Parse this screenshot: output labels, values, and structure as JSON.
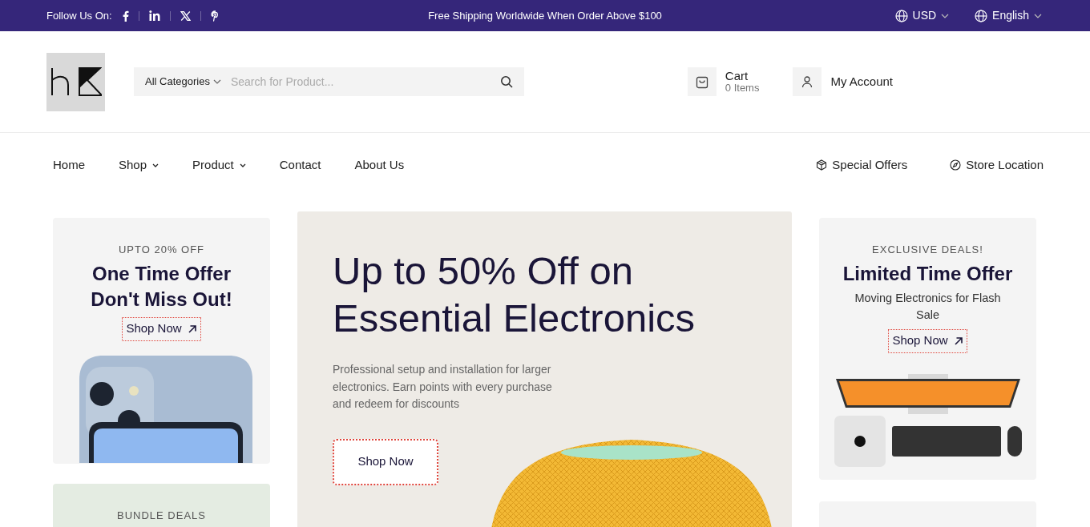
{
  "top_bar": {
    "follow_label": "Follow Us On:",
    "announcement": "Free Shipping Worldwide When Order Above $100",
    "selectors": [
      {
        "label": "USD"
      },
      {
        "label": "English"
      }
    ]
  },
  "header": {
    "category_select": "All Categories",
    "search_placeholder": "Search for Product...",
    "cart": {
      "label": "Cart",
      "count": "0 Items"
    },
    "account": "My Account"
  },
  "nav": {
    "items": [
      {
        "label": "Home",
        "dropdown": false
      },
      {
        "label": "Shop",
        "dropdown": true
      },
      {
        "label": "Product",
        "dropdown": true
      },
      {
        "label": "Contact",
        "dropdown": false
      },
      {
        "label": "About Us",
        "dropdown": false
      }
    ],
    "extras": [
      {
        "kind": "box",
        "label": "Special Offers"
      },
      {
        "kind": "compass",
        "label": "Store Location"
      }
    ]
  },
  "left_cards": [
    {
      "eyebrow": "UPTO 20% OFF",
      "title": "One Time Offer Don't Miss Out!",
      "button": "Shop Now"
    },
    {
      "eyebrow": "BUNDLE DEALS"
    }
  ],
  "hero": {
    "title": "Up to 50% Off on Essential Electronics",
    "description": "Professional setup and installation for larger electronics. Earn points with every purchase and redeem for discounts",
    "button": "Shop Now"
  },
  "right_cards": [
    {
      "eyebrow": "EXCLUSIVE DEALS!",
      "title": "Limited Time Offer",
      "subtitle": "Moving Electronics for Flash Sale",
      "button": "Shop Now"
    }
  ]
}
